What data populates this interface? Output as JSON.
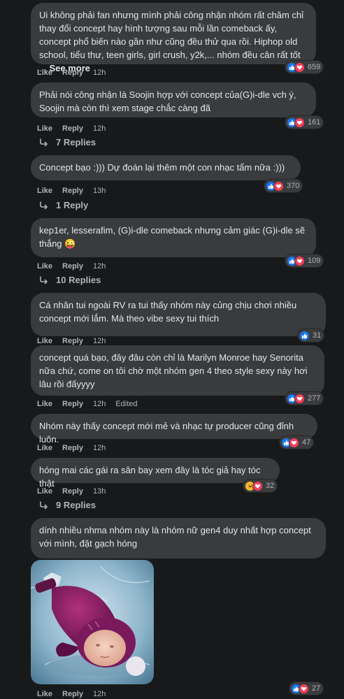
{
  "actions": {
    "like": "Like",
    "reply": "Reply",
    "edited": "Edited"
  },
  "comments": [
    {
      "text": "Ui không phải fan nhưng mình phải công nhận nhóm rất chăm chỉ thay đổi concept hay hình tượng sau mỗi lần comeback ấy, concept phổ biến nào gần như cũng đều thử qua rồi. Hiphop old school, tiểu thư, teen girls, girl crush, y2k,... nhóm đều cân rất tốt ...",
      "see_more": "See more",
      "time": "12h",
      "reactions": "659"
    },
    {
      "text": "Phải nói công nhận là Soojin hợp với concept của(G)i-dle vch ý, Soojin mà còn thì xem stage chắc càng đã",
      "time": "12h",
      "reactions": "161",
      "replies": "7 Replies"
    },
    {
      "text": "Concept bạo   :))) Dự đoán lại thêm một con nhạc tẩm      nữa :)))",
      "time": "13h",
      "reactions": "370",
      "replies": "1 Reply"
    },
    {
      "text": "kep1er, lesserafim, (G)i-dle comeback nhưng cảm giác (G)i-dle sẽ thắng",
      "emoji": "😜",
      "time": "12h",
      "reactions": "109",
      "replies": "10 Replies"
    },
    {
      "text": "Cá nhân tui ngoài RV ra tui thấy nhóm này củng chịu chơi nhiều concept mới lắm. Mà theo vibe sexy tui thích",
      "time": "12h",
      "reactions": "31"
    },
    {
      "text": "concept quá bạo, đây đâu còn chỉ là Marilyn Monroe hay Senorita nữa chứ, come on tôi chờ một nhóm gen 4 theo style sexy này hơi lâu rồi đấyyyy",
      "time": "12h",
      "edited": "Edited",
      "reactions": "277"
    },
    {
      "text": "Nhóm này thấy concept mới mẻ và nhạc tự producer cũng đỉnh luôn.",
      "time": "12h",
      "reactions": "47"
    },
    {
      "text": "hóng mai các gái ra sân bay xem đây là tóc giả hay tóc thật",
      "time": "13h",
      "reactions": "32",
      "replies": "9 Replies"
    },
    {
      "text": "dính nhiều        nhma nhóm này là nhóm nữ gen4 duy nhất hợp concept với mình, đặt gạch hóng",
      "time": "12h",
      "reactions": "27"
    }
  ],
  "icons": {
    "like": "thumbs-up-icon",
    "love": "heart-icon",
    "haha": "laughing-face-icon",
    "reply_arrow": "reply-arrow-icon"
  },
  "colors": {
    "background": "#18191a",
    "bubble": "#3a3b3c",
    "text": "#e4e6eb",
    "muted": "#b0b3b8",
    "like": "#1877f2",
    "love": "#f33e58",
    "haha": "#f7b928"
  }
}
